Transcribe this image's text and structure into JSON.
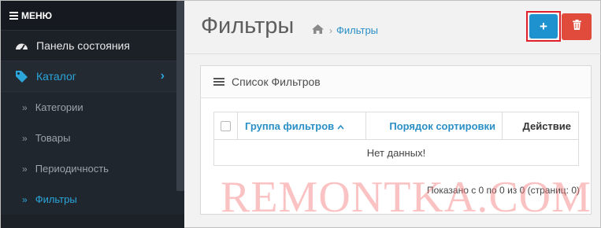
{
  "sidebar": {
    "menu_label": "МЕНЮ",
    "items": [
      {
        "label": "Панель состояния",
        "icon": "dashboard-icon"
      },
      {
        "label": "Каталог",
        "icon": "tag-icon",
        "active": true
      }
    ],
    "sub_items": [
      {
        "label": "Категории"
      },
      {
        "label": "Товары"
      },
      {
        "label": "Периодичность"
      },
      {
        "label": "Фильтры",
        "current": true
      }
    ]
  },
  "header": {
    "title": "Фильтры",
    "breadcrumb": {
      "home_icon": "home-icon",
      "current": "Фильтры"
    },
    "add_button_icon": "plus-icon",
    "delete_button_icon": "trash-icon"
  },
  "panel": {
    "title": "Список Фильтров",
    "columns": {
      "group": "Группа фильтров",
      "sort_order": "Порядок сортировки",
      "action": "Действие"
    },
    "empty_text": "Нет данных!",
    "pagination_info": "Показано с 0 по 0 из 0 (страниц: 0)"
  },
  "watermark": "REMONTKA.COM",
  "colors": {
    "accent": "#2aa6db",
    "primary_button": "#1e91cf",
    "danger_button": "#e04b3c",
    "highlight_border": "#e0212b",
    "sidebar_bg": "#1c2128"
  }
}
